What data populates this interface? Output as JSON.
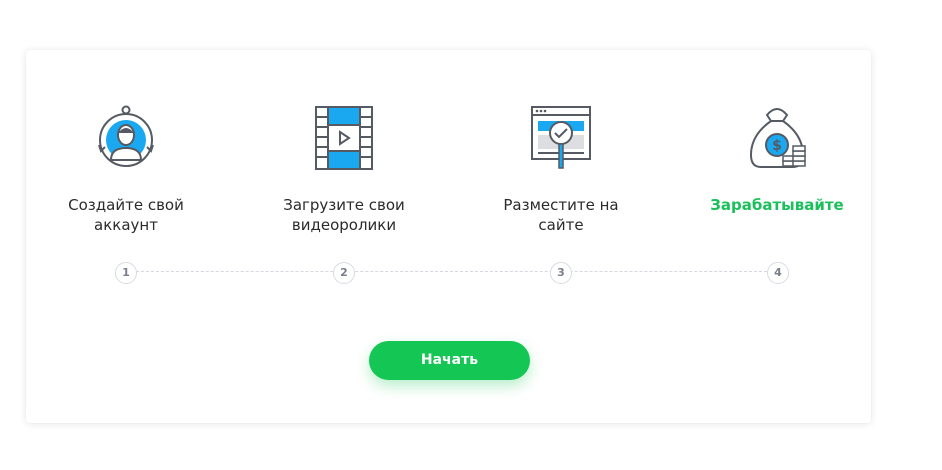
{
  "steps": [
    {
      "label": "Создайте свой\nаккаунт",
      "icon": "user-account-icon",
      "number": "1"
    },
    {
      "label": "Загрузите свои\nвидеоролики",
      "icon": "film-video-icon",
      "number": "2"
    },
    {
      "label": "Разместите на\nсайте",
      "icon": "website-embed-icon",
      "number": "3"
    },
    {
      "label": "Зарабатывайте",
      "icon": "money-bag-icon",
      "number": "4"
    }
  ],
  "start_button": {
    "label": "Начать"
  },
  "colors": {
    "accent_green": "#14c653",
    "icon_blue": "#1aa9f0",
    "icon_stroke": "#555a63"
  }
}
